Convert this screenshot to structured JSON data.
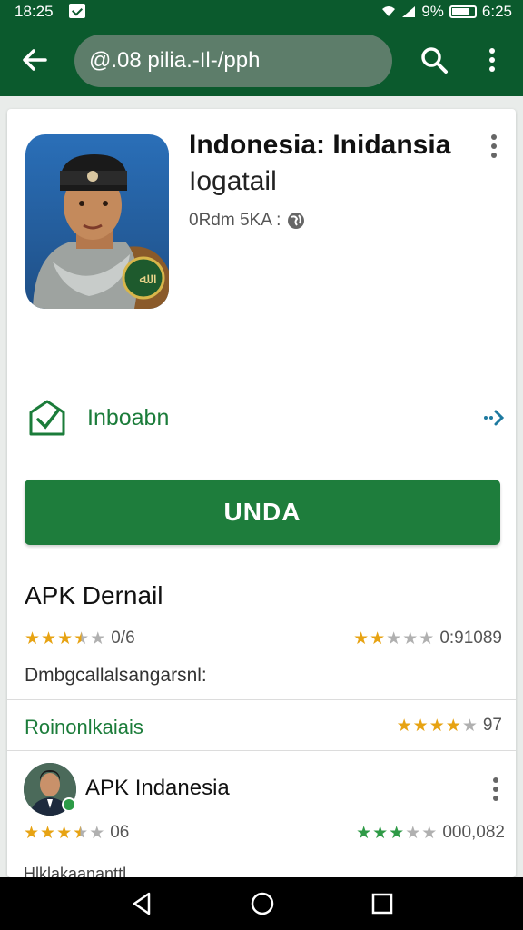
{
  "status_bar": {
    "time": "18:25",
    "battery": "9%",
    "clock_right": "6:25"
  },
  "toolbar": {
    "search_value": "@.08 pilia.-Il-/pph",
    "back_icon": "arrow-left-icon",
    "search_icon": "search-icon",
    "menu_icon": "more-vert-icon"
  },
  "app": {
    "title": "Indonesia: Inidansia",
    "subtitle": "Iogatail",
    "meta": "0Rdm 5KA :",
    "installed_label": "Inboabn",
    "primary_button": "UNDA"
  },
  "details": {
    "section_title": "APK Dernail",
    "left_value": "0/6",
    "left_stars": 3.5,
    "right_value": "0:91089",
    "right_stars": 2,
    "description": "Dmbgcallalsangarsnl:",
    "reviews_label": "Roinonlkaiais",
    "reviews_value": "97",
    "reviews_stars": 4
  },
  "review": {
    "author": "APK Indanesia",
    "left_value": "06",
    "left_stars": 3.5,
    "right_value": "000,082",
    "right_stars": 3,
    "snippet": "Hlklakaananttl"
  },
  "colors": {
    "brand_dark": "#0b5a2d",
    "brand": "#1e7d3c",
    "accent_green": "#1b7c3a",
    "star_gold": "#e7a313",
    "star_green": "#2e9a46",
    "star_empty": "#b0b0b0"
  }
}
